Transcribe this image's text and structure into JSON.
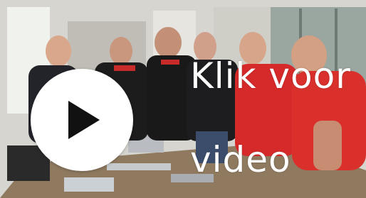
{
  "video": {
    "overlay_line_1": "Klik voor",
    "overlay_line_2": "video",
    "play_icon": "play-icon",
    "colors": {
      "overlay_text": "#ffffff",
      "play_circle": "#ffffff",
      "play_triangle": "#111111",
      "shirt_red": "#d62a2a",
      "shirt_black": "#1c1c1c"
    }
  }
}
